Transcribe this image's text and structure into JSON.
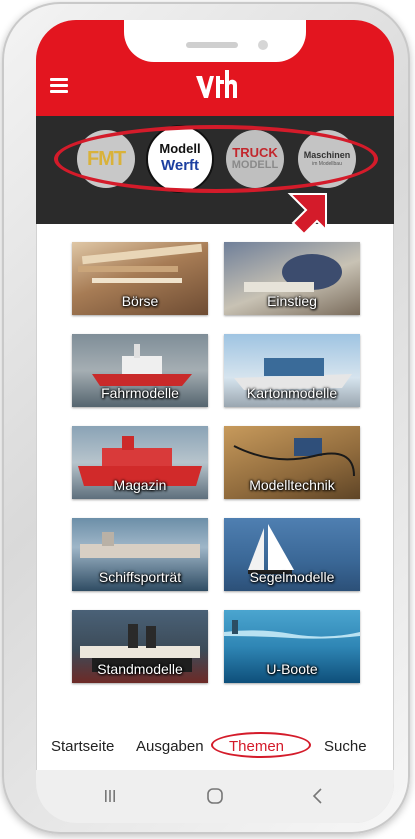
{
  "app": {
    "logo_text": "vth",
    "brand_color": "#e3151f",
    "magazine_bar_color": "#2b2b2b",
    "highlight_color": "#d41b2a"
  },
  "header": {
    "menu_icon": "hamburger-menu-icon"
  },
  "magazines": [
    {
      "name": "FMT",
      "lines": [
        "FMT"
      ],
      "selected": false
    },
    {
      "name": "ModellWerft",
      "lines": [
        "Modell",
        "Werft"
      ],
      "selected": true
    },
    {
      "name": "TruckModell",
      "lines": [
        "TRUCK",
        "MODELL"
      ],
      "selected": false
    },
    {
      "name": "Maschinen im Modellbau",
      "lines": [
        "Maschinen",
        "im Modellbau"
      ],
      "selected": false
    }
  ],
  "topics": [
    {
      "label": "Börse"
    },
    {
      "label": "Einstieg"
    },
    {
      "label": "Fahrmodelle"
    },
    {
      "label": "Kartonmodelle"
    },
    {
      "label": "Magazin"
    },
    {
      "label": "Modelltechnik"
    },
    {
      "label": "Schiffsporträt"
    },
    {
      "label": "Segelmodelle"
    },
    {
      "label": "Standmodelle"
    },
    {
      "label": "U-Boote"
    }
  ],
  "bottom_nav": {
    "items": [
      "Startseite",
      "Ausgaben",
      "Themen",
      "Suche"
    ],
    "active": "Themen"
  },
  "system_nav": {
    "recent_icon": "recent-apps-icon",
    "home_icon": "home-icon",
    "back_icon": "back-icon"
  }
}
